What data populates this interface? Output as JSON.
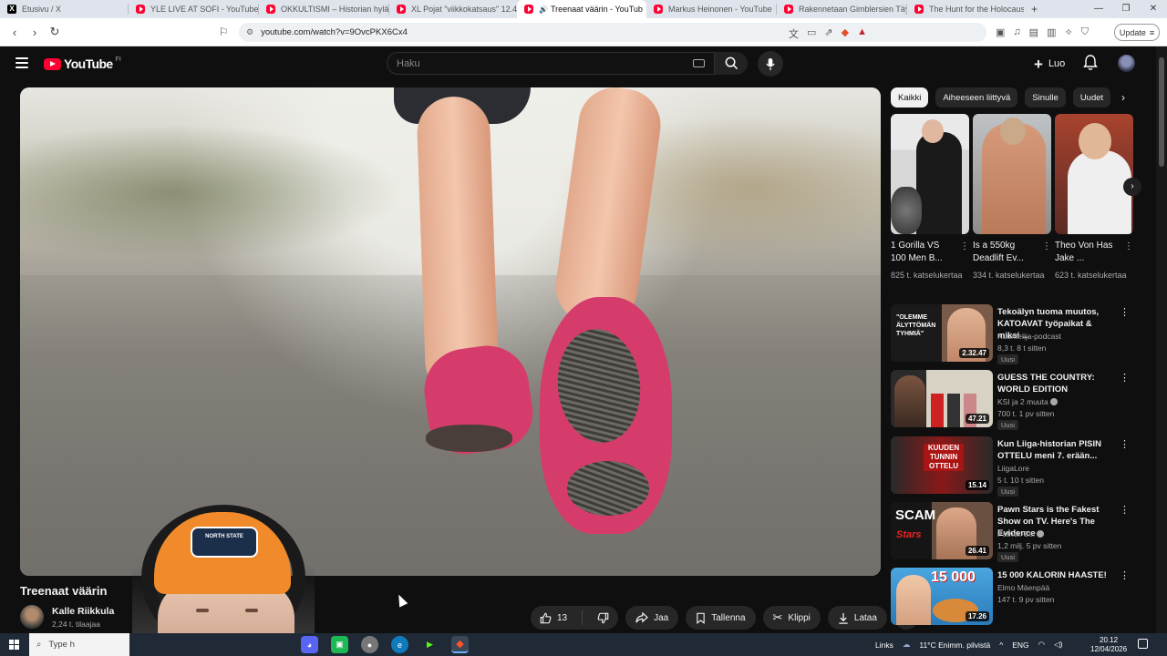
{
  "browser": {
    "tabs": [
      {
        "title": "Etusivu / X",
        "icon": "x-logo-icon"
      },
      {
        "title": "YLE LIVE AT SOFI - YouTube",
        "icon": "youtube-icon"
      },
      {
        "title": "OKKULTISMI – Historian hylätt",
        "icon": "youtube-icon"
      },
      {
        "title": "XL Pojat \"viikkokatsaus\" 12.4 -",
        "icon": "youtube-icon"
      },
      {
        "title": "Treenaat väärin - YouTub",
        "icon": "youtube-icon",
        "active": true
      },
      {
        "title": "Markus Heinonen - YouTube",
        "icon": "youtube-icon"
      },
      {
        "title": "Rakennetaan Gimblersien Täy",
        "icon": "youtube-icon"
      },
      {
        "title": "The Hunt for the Holocaust Ar",
        "icon": "youtube-icon"
      }
    ],
    "new_tab": "+",
    "url": "youtube.com/watch?v=9OvcPKX6Cx4",
    "update_label": "Update"
  },
  "youtube": {
    "logo_text": "YouTube",
    "region": "FI",
    "search_placeholder": "Haku",
    "create_label": "Luo"
  },
  "video": {
    "title": "Treenaat väärin",
    "channel": "Kalle Riikkula",
    "subscribers": "2,24 t. tilaajaa",
    "likes": "13",
    "share_label": "Jaa",
    "save_label": "Tallenna",
    "clip_label": "Klippi",
    "download_label": "Lataa",
    "webcam_cap_text": "NORTH STATE"
  },
  "sidebar": {
    "chips": [
      "Kaikki",
      "Aiheeseen liittyvä",
      "Sinulle",
      "Uudet"
    ],
    "shorts": [
      {
        "title": "1 Gorilla VS 100 Men B...",
        "views": "825 t. katselukertaa"
      },
      {
        "title": "Is a 550kg Deadlift Ev...",
        "views": "334 t. katselukertaa"
      },
      {
        "title": "Theo Von Has Jake ...",
        "views": "623 t. katselukertaa"
      }
    ],
    "videos": [
      {
        "title": "Tekoälyn tuoma muutos, KATOAVAT työpaikat & miksi ...",
        "channel": "Kuuntelija-podcast",
        "meta": "8,3 t.  8 t sitten",
        "badge": "Uusi",
        "duration": "2.32.47",
        "thumb_text": "\"OLEMME ÄLYTTÖMÄN TYHMIÄ\""
      },
      {
        "title": "GUESS THE COUNTRY: WORLD EDITION",
        "channel": "KSI ja 2 muuta",
        "meta": "700 t.  1 pv sitten",
        "badge": "Uusi",
        "duration": "47.21"
      },
      {
        "title": "Kun Liiga-historian PISIN OTTELU meni 7. erään...",
        "channel": "LiigaLore",
        "meta": "5 t.  10 t sitten",
        "badge": "Uusi",
        "duration": "15.14",
        "thumb_text": "KUUDEN TUNNIN OTTELU"
      },
      {
        "title": "Pawn Stars is the Fakest Show on TV. Here's The Evidence",
        "channel": "Patrick Cc:",
        "meta": "1,2 milj.  5 pv sitten",
        "badge": "Uusi",
        "duration": "26.41",
        "thumb_text": "SCAM"
      },
      {
        "title": "15 000 KALORIN HAASTE!",
        "channel": "Elmo Mäenpää",
        "meta": "147 t.  9 pv sitten",
        "duration": "17.26",
        "thumb_text": "15 000"
      }
    ]
  },
  "taskbar": {
    "search_placeholder": "Type h",
    "links_label": "Links",
    "weather": "11°C  Enimm. pilvistä",
    "language": "ENG",
    "time": "20.12",
    "date": "12/04/2026"
  }
}
